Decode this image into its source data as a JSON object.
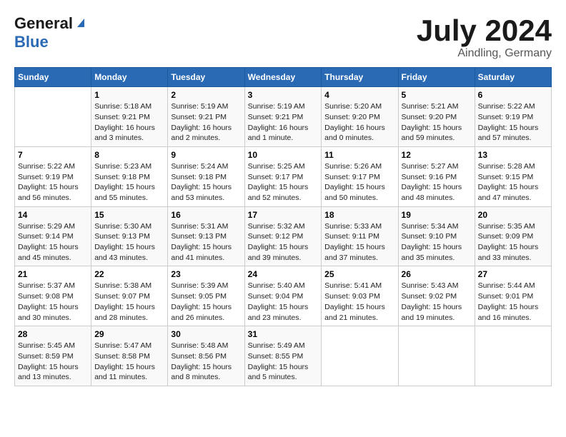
{
  "header": {
    "logo_general": "General",
    "logo_blue": "Blue",
    "month_year": "July 2024",
    "location": "Aindling, Germany"
  },
  "weekdays": [
    "Sunday",
    "Monday",
    "Tuesday",
    "Wednesday",
    "Thursday",
    "Friday",
    "Saturday"
  ],
  "weeks": [
    [
      {
        "day": "",
        "info": ""
      },
      {
        "day": "1",
        "info": "Sunrise: 5:18 AM\nSunset: 9:21 PM\nDaylight: 16 hours\nand 3 minutes."
      },
      {
        "day": "2",
        "info": "Sunrise: 5:19 AM\nSunset: 9:21 PM\nDaylight: 16 hours\nand 2 minutes."
      },
      {
        "day": "3",
        "info": "Sunrise: 5:19 AM\nSunset: 9:21 PM\nDaylight: 16 hours\nand 1 minute."
      },
      {
        "day": "4",
        "info": "Sunrise: 5:20 AM\nSunset: 9:20 PM\nDaylight: 16 hours\nand 0 minutes."
      },
      {
        "day": "5",
        "info": "Sunrise: 5:21 AM\nSunset: 9:20 PM\nDaylight: 15 hours\nand 59 minutes."
      },
      {
        "day": "6",
        "info": "Sunrise: 5:22 AM\nSunset: 9:19 PM\nDaylight: 15 hours\nand 57 minutes."
      }
    ],
    [
      {
        "day": "7",
        "info": "Sunrise: 5:22 AM\nSunset: 9:19 PM\nDaylight: 15 hours\nand 56 minutes."
      },
      {
        "day": "8",
        "info": "Sunrise: 5:23 AM\nSunset: 9:18 PM\nDaylight: 15 hours\nand 55 minutes."
      },
      {
        "day": "9",
        "info": "Sunrise: 5:24 AM\nSunset: 9:18 PM\nDaylight: 15 hours\nand 53 minutes."
      },
      {
        "day": "10",
        "info": "Sunrise: 5:25 AM\nSunset: 9:17 PM\nDaylight: 15 hours\nand 52 minutes."
      },
      {
        "day": "11",
        "info": "Sunrise: 5:26 AM\nSunset: 9:17 PM\nDaylight: 15 hours\nand 50 minutes."
      },
      {
        "day": "12",
        "info": "Sunrise: 5:27 AM\nSunset: 9:16 PM\nDaylight: 15 hours\nand 48 minutes."
      },
      {
        "day": "13",
        "info": "Sunrise: 5:28 AM\nSunset: 9:15 PM\nDaylight: 15 hours\nand 47 minutes."
      }
    ],
    [
      {
        "day": "14",
        "info": "Sunrise: 5:29 AM\nSunset: 9:14 PM\nDaylight: 15 hours\nand 45 minutes."
      },
      {
        "day": "15",
        "info": "Sunrise: 5:30 AM\nSunset: 9:13 PM\nDaylight: 15 hours\nand 43 minutes."
      },
      {
        "day": "16",
        "info": "Sunrise: 5:31 AM\nSunset: 9:13 PM\nDaylight: 15 hours\nand 41 minutes."
      },
      {
        "day": "17",
        "info": "Sunrise: 5:32 AM\nSunset: 9:12 PM\nDaylight: 15 hours\nand 39 minutes."
      },
      {
        "day": "18",
        "info": "Sunrise: 5:33 AM\nSunset: 9:11 PM\nDaylight: 15 hours\nand 37 minutes."
      },
      {
        "day": "19",
        "info": "Sunrise: 5:34 AM\nSunset: 9:10 PM\nDaylight: 15 hours\nand 35 minutes."
      },
      {
        "day": "20",
        "info": "Sunrise: 5:35 AM\nSunset: 9:09 PM\nDaylight: 15 hours\nand 33 minutes."
      }
    ],
    [
      {
        "day": "21",
        "info": "Sunrise: 5:37 AM\nSunset: 9:08 PM\nDaylight: 15 hours\nand 30 minutes."
      },
      {
        "day": "22",
        "info": "Sunrise: 5:38 AM\nSunset: 9:07 PM\nDaylight: 15 hours\nand 28 minutes."
      },
      {
        "day": "23",
        "info": "Sunrise: 5:39 AM\nSunset: 9:05 PM\nDaylight: 15 hours\nand 26 minutes."
      },
      {
        "day": "24",
        "info": "Sunrise: 5:40 AM\nSunset: 9:04 PM\nDaylight: 15 hours\nand 23 minutes."
      },
      {
        "day": "25",
        "info": "Sunrise: 5:41 AM\nSunset: 9:03 PM\nDaylight: 15 hours\nand 21 minutes."
      },
      {
        "day": "26",
        "info": "Sunrise: 5:43 AM\nSunset: 9:02 PM\nDaylight: 15 hours\nand 19 minutes."
      },
      {
        "day": "27",
        "info": "Sunrise: 5:44 AM\nSunset: 9:01 PM\nDaylight: 15 hours\nand 16 minutes."
      }
    ],
    [
      {
        "day": "28",
        "info": "Sunrise: 5:45 AM\nSunset: 8:59 PM\nDaylight: 15 hours\nand 13 minutes."
      },
      {
        "day": "29",
        "info": "Sunrise: 5:47 AM\nSunset: 8:58 PM\nDaylight: 15 hours\nand 11 minutes."
      },
      {
        "day": "30",
        "info": "Sunrise: 5:48 AM\nSunset: 8:56 PM\nDaylight: 15 hours\nand 8 minutes."
      },
      {
        "day": "31",
        "info": "Sunrise: 5:49 AM\nSunset: 8:55 PM\nDaylight: 15 hours\nand 5 minutes."
      },
      {
        "day": "",
        "info": ""
      },
      {
        "day": "",
        "info": ""
      },
      {
        "day": "",
        "info": ""
      }
    ]
  ]
}
